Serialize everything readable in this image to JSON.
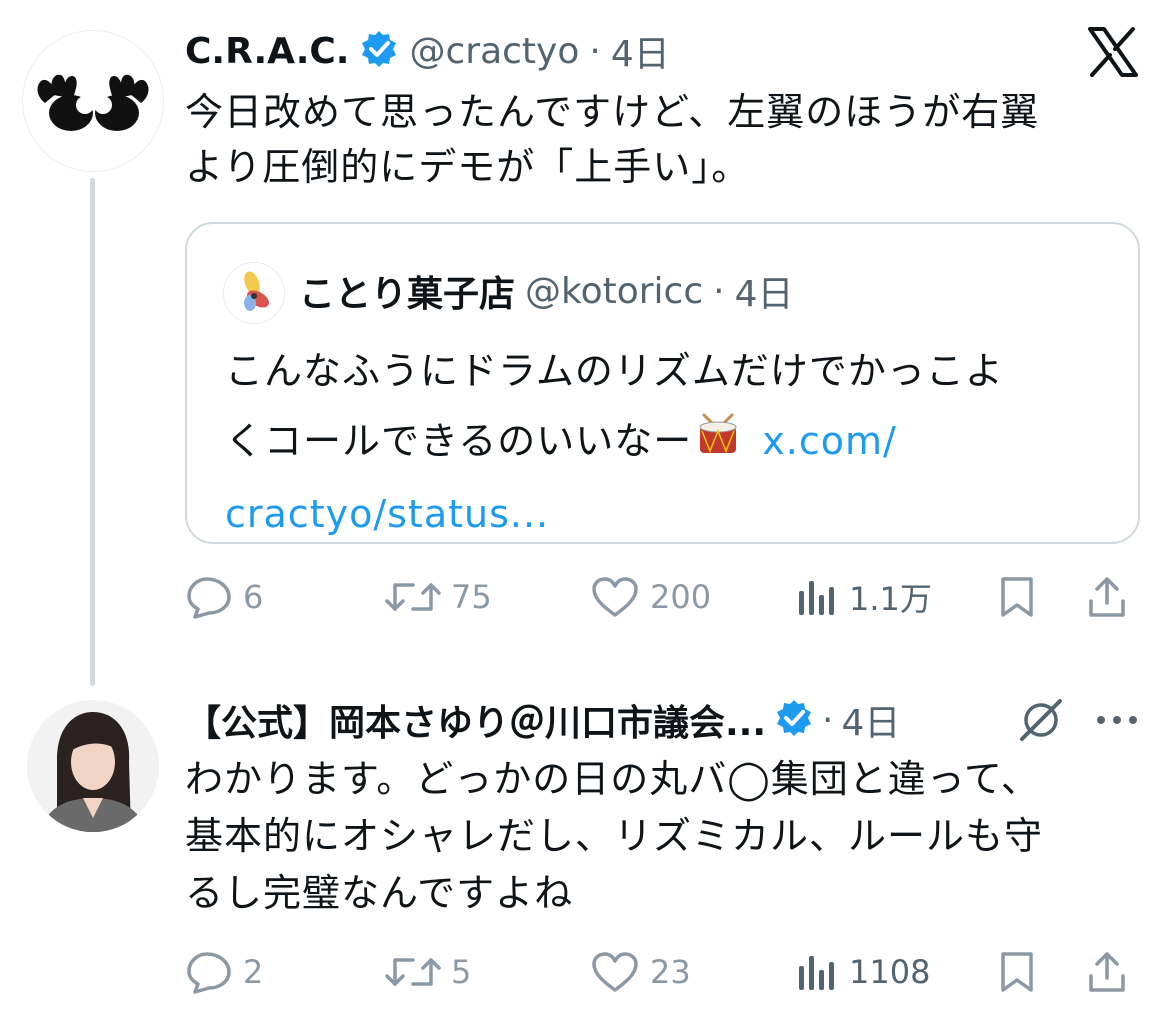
{
  "tweet1": {
    "author_name": "C.R.A.C.",
    "handle": "@cractyo",
    "time": "4日",
    "text_line1": "今日改めて思ったんですけど、左翼のほうが右翼",
    "text_line2": "より圧倒的にデモが「上手い」。",
    "actions": {
      "replies": "6",
      "retweets": "75",
      "likes": "200",
      "views": "1.1万"
    }
  },
  "quote": {
    "author_name": "ことり菓子店",
    "handle": "@kotoricc",
    "time": "4日",
    "text_line1": "こんなふうにドラムのリズムだけでかっこよ",
    "text_line2": "くコールできるのいいなー",
    "link_part1": "x.com/",
    "link_part2": "cractyo/status..."
  },
  "tweet2": {
    "author_name": "【公式】岡本さゆり＠川口市議会...",
    "time": "4日",
    "text_line1": "わかります。どっかの日の丸バ◯集団と違って、",
    "text_line2": "基本的にオシャレだし、リズミカル、ルールも守",
    "text_line3": "るし完璧なんですよね",
    "actions": {
      "replies": "2",
      "retweets": "5",
      "likes": "23",
      "views": "1108"
    }
  },
  "colors": {
    "accent": "#1d9bf0",
    "muted": "#536471",
    "light_muted": "#8b98a5",
    "border": "#cfd9de"
  },
  "icons": [
    "x-logo-icon",
    "verified-icon",
    "reply-icon",
    "retweet-icon",
    "like-icon",
    "views-icon",
    "bookmark-icon",
    "share-icon",
    "grok-icon",
    "more-icon",
    "drum-icon"
  ]
}
